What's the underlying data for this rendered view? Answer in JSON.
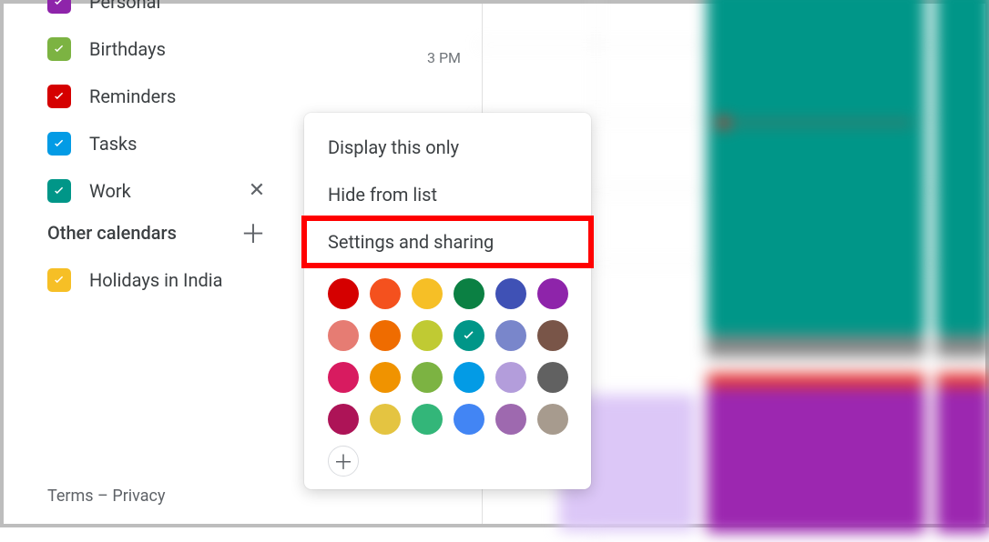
{
  "sidebar": {
    "my_calendars": [
      {
        "label": "Personal",
        "color": "#8e24aa",
        "checked": true,
        "active": false
      },
      {
        "label": "Birthdays",
        "color": "#7cb342",
        "checked": true,
        "active": false
      },
      {
        "label": "Reminders",
        "color": "#d50000",
        "checked": true,
        "active": false
      },
      {
        "label": "Tasks",
        "color": "#039be5",
        "checked": true,
        "active": false
      },
      {
        "label": "Work",
        "color": "#009688",
        "checked": true,
        "active": true
      }
    ],
    "other_header": "Other calendars",
    "other_calendars": [
      {
        "label": "Holidays in India",
        "color": "#f6bf26",
        "checked": true
      }
    ]
  },
  "grid": {
    "time_label": "3 PM"
  },
  "context_menu": {
    "items": [
      {
        "label": "Display this only",
        "highlighted": false
      },
      {
        "label": "Hide from list",
        "highlighted": false
      },
      {
        "label": "Settings and sharing",
        "highlighted": true
      }
    ],
    "colors": [
      "#d50000",
      "#f4511e",
      "#f6bf26",
      "#0b8043",
      "#3f51b5",
      "#8e24aa",
      "#e67c73",
      "#ef6c00",
      "#c0ca33",
      "#009688",
      "#7986cb",
      "#795548",
      "#d81b60",
      "#f09300",
      "#7cb342",
      "#039be5",
      "#b39ddb",
      "#616161",
      "#ad1457",
      "#e4c441",
      "#33b679",
      "#4285f4",
      "#9e69af",
      "#a79b8e"
    ],
    "selected_color_index": 9
  },
  "footer": {
    "terms": "Terms",
    "sep": " – ",
    "privacy": "Privacy"
  }
}
